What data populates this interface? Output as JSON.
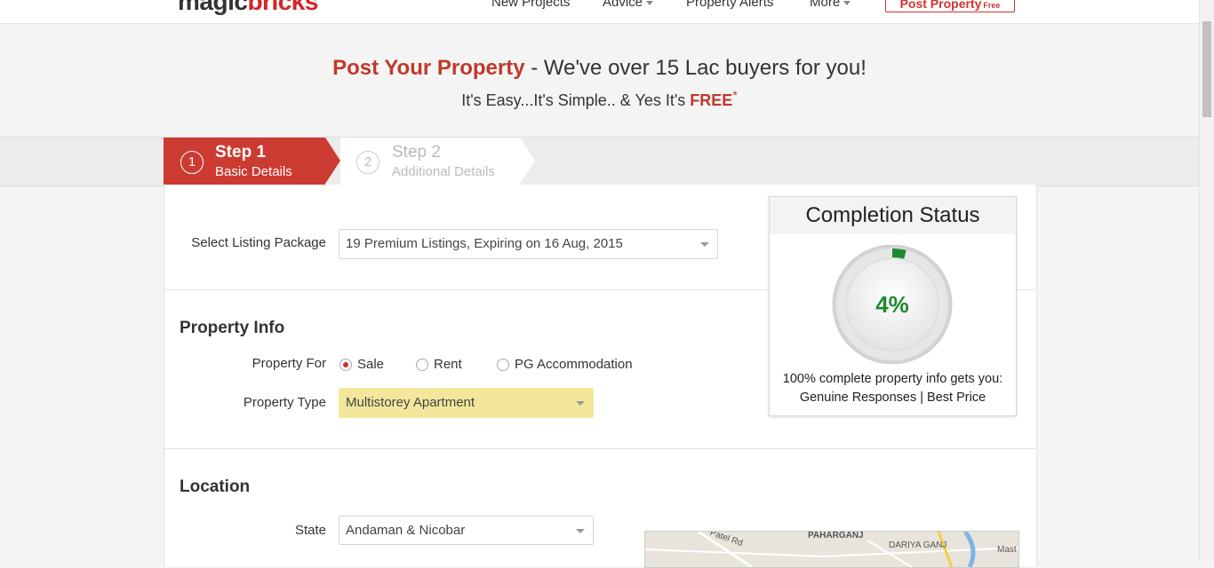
{
  "nav": {
    "logo_part1": "magic",
    "logo_part2": "bricks",
    "items": [
      {
        "label": "New Projects"
      },
      {
        "label": "Advice"
      },
      {
        "label": "Property Alerts"
      },
      {
        "label": "More"
      }
    ],
    "post_property": "Post Property",
    "post_property_free": "Free"
  },
  "hero": {
    "title_highlight": "Post Your Property",
    "title_rest": " - We've over 15 Lac buyers for you!",
    "subtitle_pre": "It's Easy...It's Simple.. & Yes It's ",
    "subtitle_free": "FREE",
    "subtitle_star": "*"
  },
  "steps": [
    {
      "number": "1",
      "title": "Step 1",
      "subtitle": "Basic Details"
    },
    {
      "number": "2",
      "title": "Step 2",
      "subtitle": "Additional Details"
    }
  ],
  "listing": {
    "label": "Select Listing Package",
    "value": "19 Premium Listings, Expiring on 16 Aug, 2015"
  },
  "property_info": {
    "title": "Property Info",
    "for_label": "Property For",
    "options": [
      "Sale",
      "Rent",
      "PG Accommodation"
    ],
    "selected": "Sale",
    "type_label": "Property Type",
    "type_value": "Multistorey Apartment"
  },
  "location": {
    "title": "Location",
    "state_label": "State",
    "state_value": "Andaman & Nicobar",
    "map_labels": [
      "Patel Rd",
      "PAHARGANJ",
      "DARIYA GANJ",
      "Mast"
    ]
  },
  "completion": {
    "title": "Completion Status",
    "percent": 4,
    "percent_label": "4%",
    "line1": "100% complete property info gets you:",
    "line2": "Genuine Responses | Best Price"
  },
  "colors": {
    "brand_red": "#cc3b31",
    "progress_green": "#1e8a2e",
    "type_highlight": "#f3e79b"
  }
}
